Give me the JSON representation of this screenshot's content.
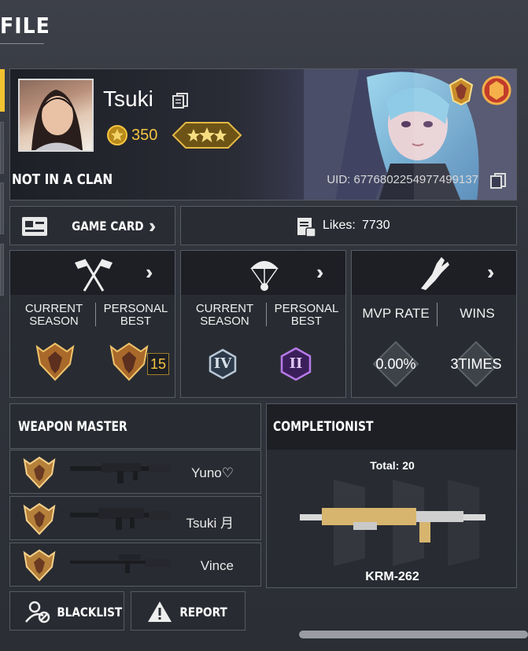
{
  "page": {
    "title": "FILE"
  },
  "profile": {
    "name": "Tsuki",
    "level": "350",
    "clan": "NOT IN A CLAN",
    "uid": "UID: 6776802254977499137"
  },
  "buttons": {
    "game_card": "GAME CARD",
    "likes_label": "Likes:",
    "likes_value": "7730",
    "blacklist": "BLACKLIST",
    "report": "REPORT"
  },
  "stats": {
    "ranked_mp": {
      "current_season": "CURRENT\nSEASON",
      "personal_best": "PERSONAL\nBEST",
      "best_number": "15"
    },
    "battle_royale": {
      "current_season": "CURRENT\nSEASON",
      "personal_best": "PERSONAL\nBEST",
      "current_tier": "IV",
      "best_tier": "II"
    },
    "performance": {
      "mvp_label": "MVP RATE",
      "wins_label": "WINS",
      "mvp_value": "0.00%",
      "wins_value": "3TIMES"
    }
  },
  "weapon_master": {
    "title": "WEAPON MASTER",
    "rows": [
      {
        "player": "Yuno♡"
      },
      {
        "player": "Tsuki 月"
      },
      {
        "player": "Vince"
      }
    ]
  },
  "completionist": {
    "title": "COMPLETIONIST",
    "total": "Total: 20",
    "weapon": "KRM-262"
  },
  "colors": {
    "accent": "#f2c230",
    "gold": "#f5c542",
    "panel": "#282b32"
  }
}
